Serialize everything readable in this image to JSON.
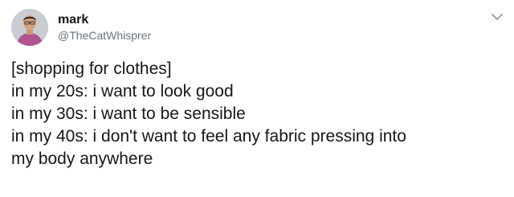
{
  "tweet": {
    "author": {
      "display_name": "mark",
      "handle": "@TheCatWhisprer"
    },
    "lines": [
      "[shopping for clothes]",
      "in my 20s: i want to look good",
      "in my 30s: i want to be sensible",
      "in my 40s: i don't want to feel any fabric pressing into",
      "my body anywhere"
    ]
  },
  "icons": {
    "avatar": "avatar-photo",
    "menu": "chevron-down-icon"
  },
  "colors": {
    "text": "#14171a",
    "secondary_text": "#657786",
    "chevron": "#8899a6",
    "background": "#ffffff"
  }
}
